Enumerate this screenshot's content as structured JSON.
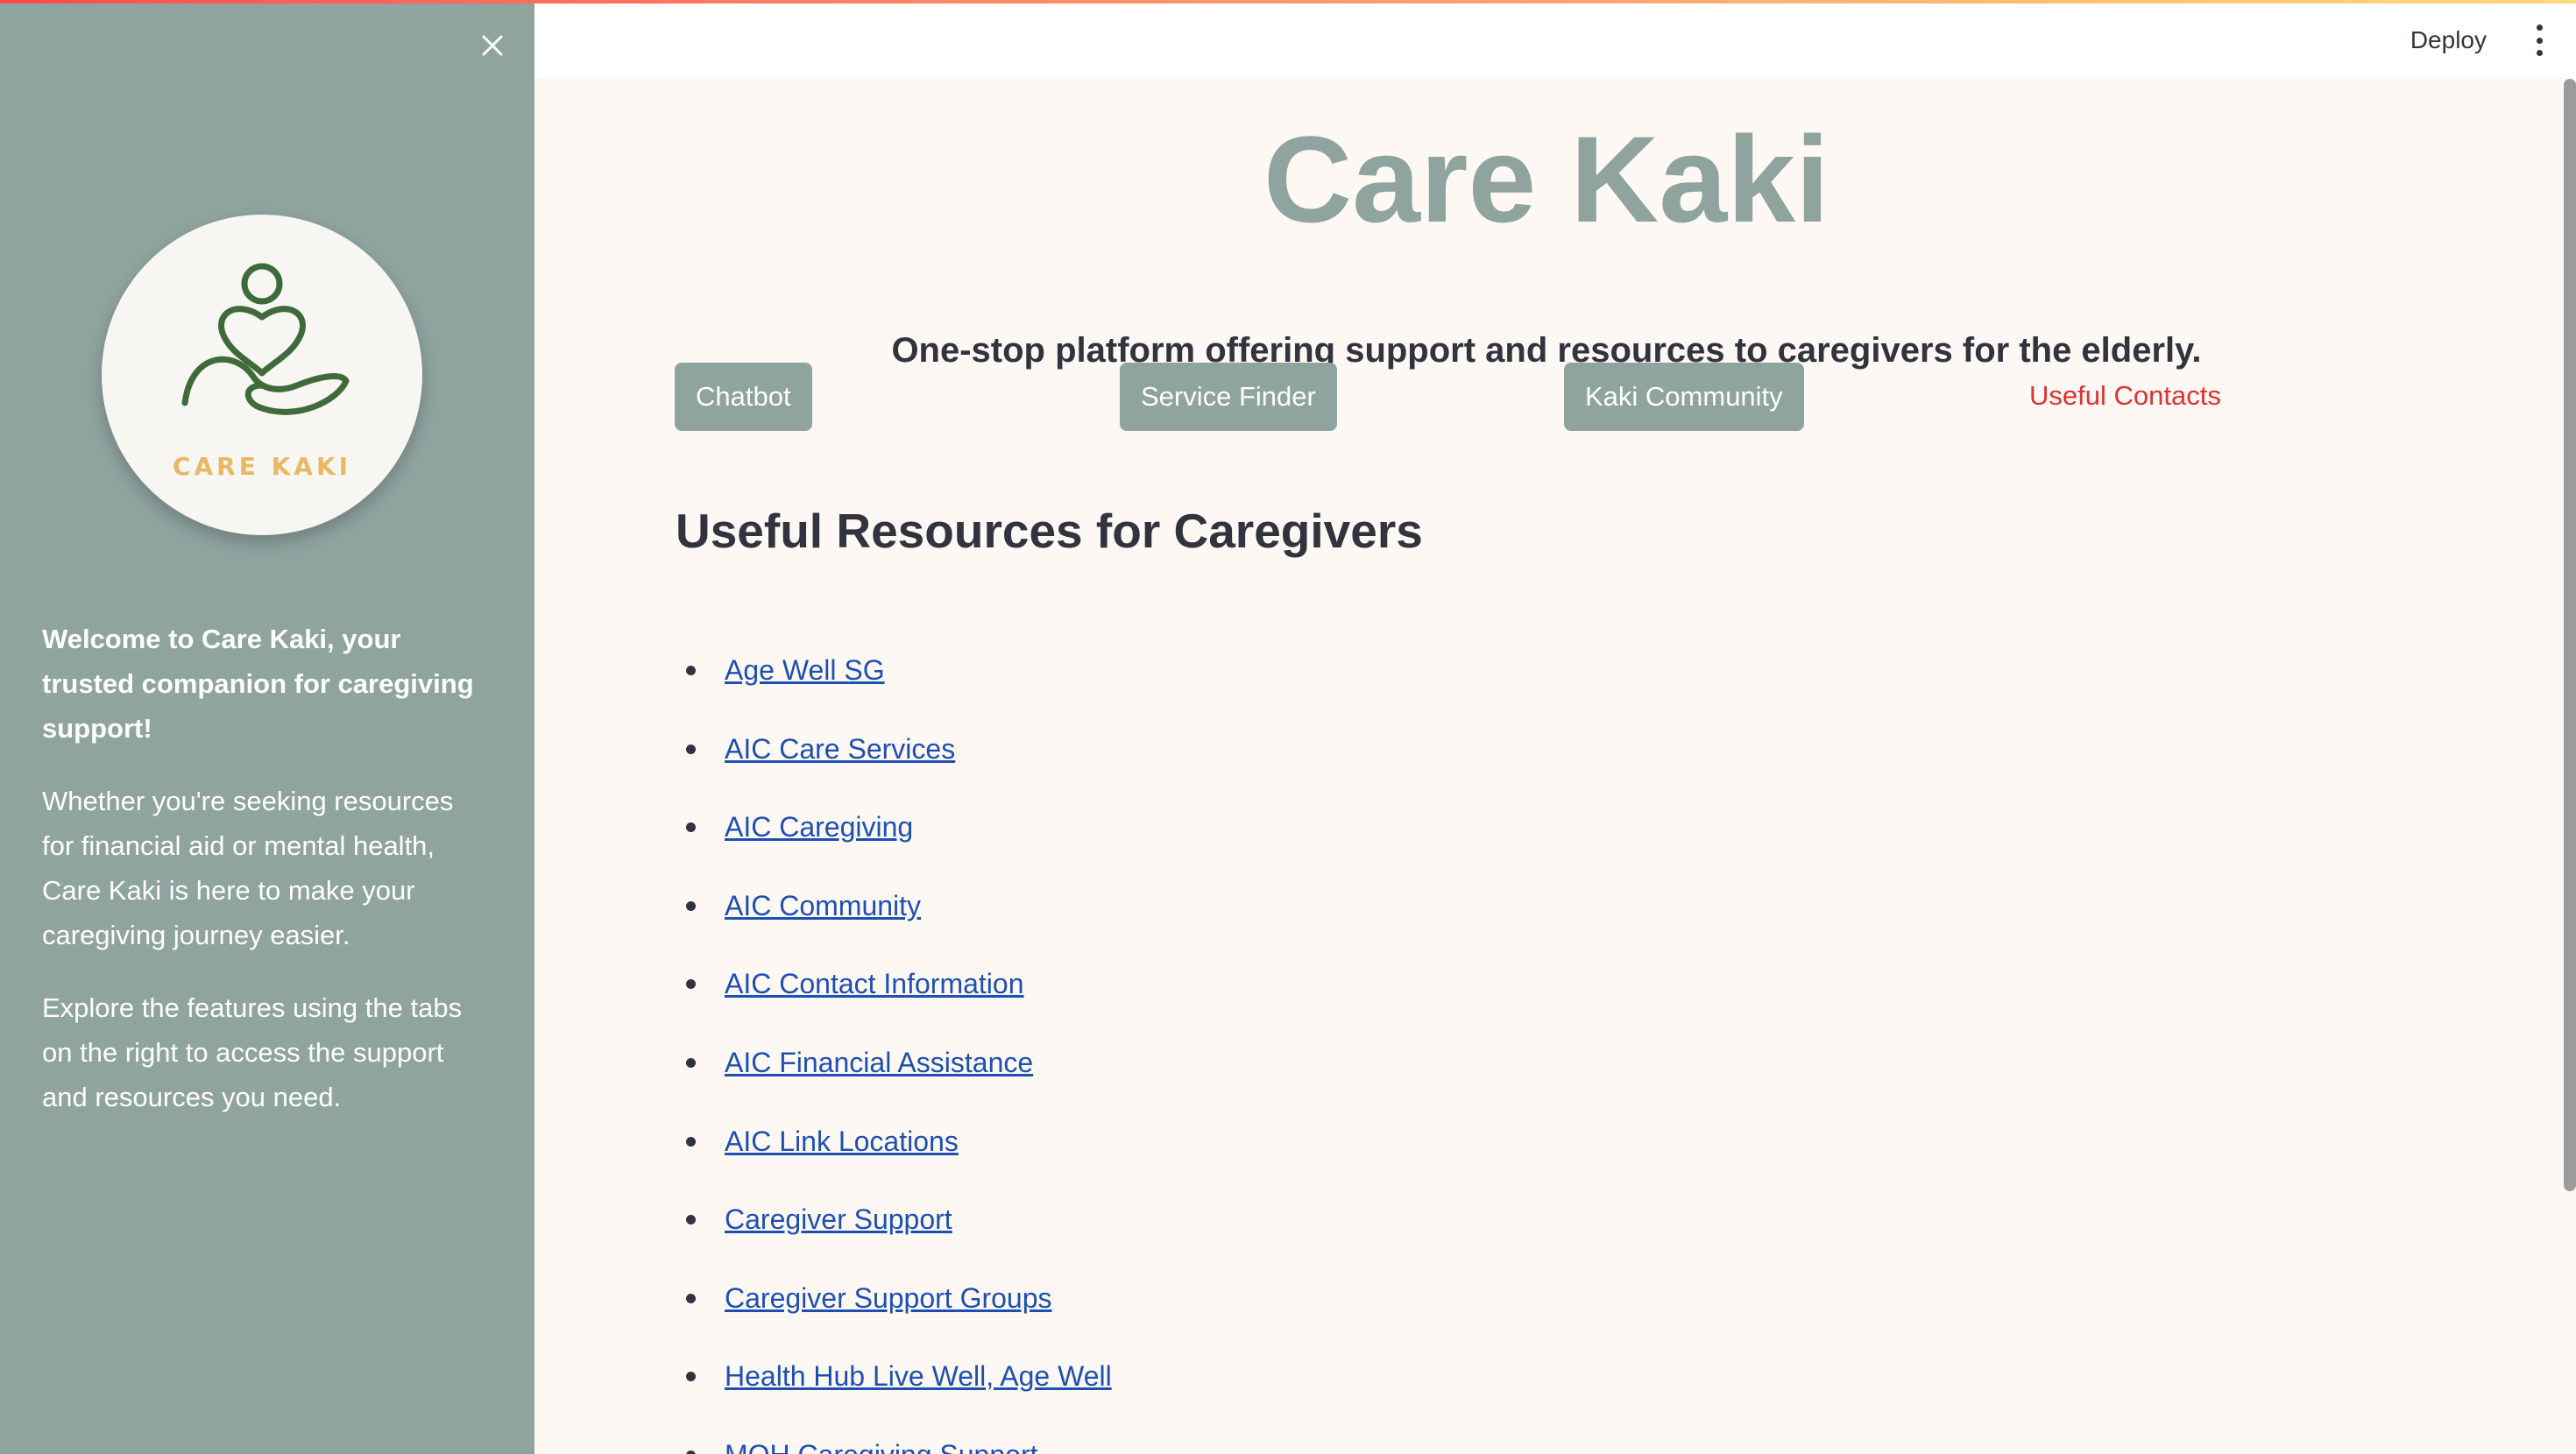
{
  "sidebar": {
    "logo_text": "CARE KAKI",
    "welcome": "Welcome to Care Kaki, your trusted companion for caregiving support!",
    "paragraph1": "Whether you're seeking resources for financial aid or mental health, Care Kaki is here to make your caregiving journey easier.",
    "paragraph2": "Explore the features using the tabs on the right to access the support and resources you need."
  },
  "header": {
    "deploy_label": "Deploy"
  },
  "main": {
    "title": "Care Kaki",
    "subtitle": "One-stop platform offering support and resources to caregivers for the elderly.",
    "nav": {
      "chatbot": "Chatbot",
      "service_finder": "Service Finder",
      "kaki_community": "Kaki Community",
      "useful_contacts": "Useful Contacts"
    },
    "section_title": "Useful Resources for Caregivers",
    "resources": [
      "Age Well SG",
      "AIC Care Services",
      "AIC Caregiving",
      "AIC Community",
      "AIC Contact Information",
      "AIC Financial Assistance",
      "AIC Link Locations",
      "Caregiver Support",
      "Caregiver Support Groups",
      "Health Hub Live Well, Age Well",
      "MOH Caregiving Support"
    ]
  },
  "colors": {
    "sidebar_bg": "#8fa39f",
    "main_bg": "#fdf8f3",
    "accent": "#8fa39f",
    "link": "#1e4fb3",
    "active_tab": "#e03131",
    "logo_gold": "#e8b865",
    "logo_green": "#3f6a3a"
  }
}
